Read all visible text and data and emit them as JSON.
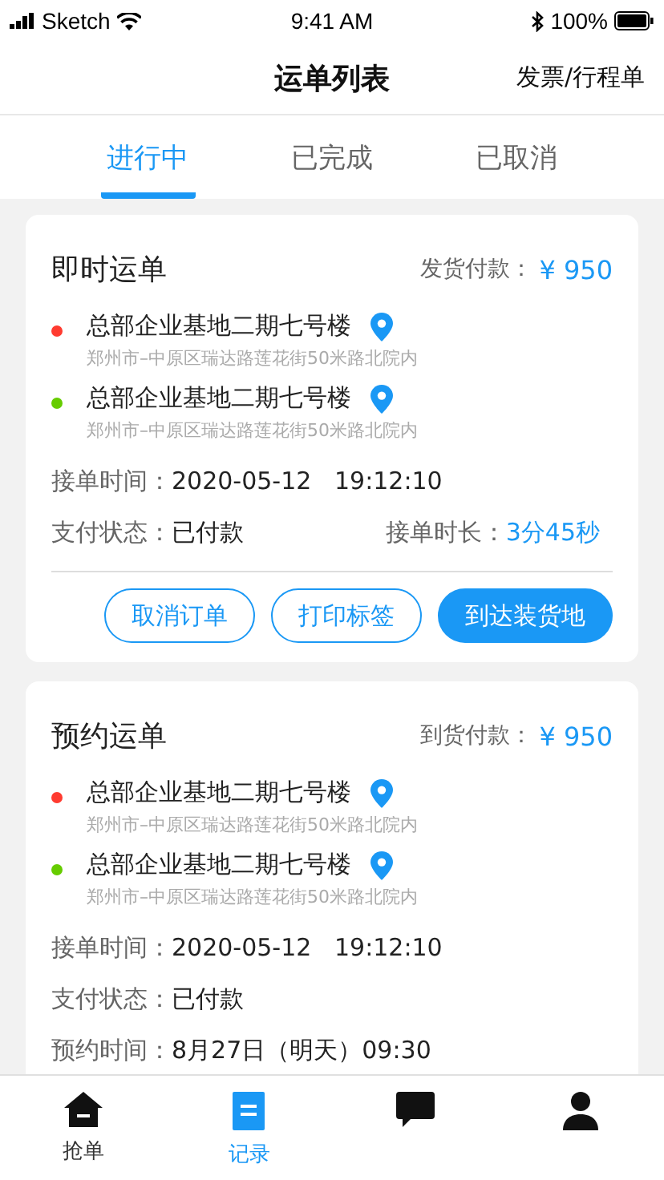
{
  "status_bar": {
    "carrier": "Sketch",
    "time": "9:41 AM",
    "battery": "100%"
  },
  "nav": {
    "title": "运单列表",
    "action": "发票/行程单"
  },
  "tabs": [
    {
      "label": "进行中",
      "selected": true
    },
    {
      "label": "已完成",
      "selected": false
    },
    {
      "label": "已取消",
      "selected": false
    }
  ],
  "orders": [
    {
      "type": "即时运单",
      "payment_label": "发货付款：",
      "amount": "¥ 950",
      "stops": [
        {
          "name": "总部企业基地二期七号楼",
          "address": "郑州市–中原区瑞达路莲花街50米路北院内",
          "color": "#ff3b30"
        },
        {
          "name": "总部企业基地二期七号楼",
          "address": "郑州市–中原区瑞达路莲花街50米路北院内",
          "color": "#66cc00"
        }
      ],
      "fields": [
        {
          "label": "接单时间：",
          "value": "2020-05-12   19:12:10",
          "kind": "plain"
        },
        {
          "label": "支付状态：",
          "value": "已付款",
          "kind": "pair",
          "extra_label": "接单时长：",
          "extra_value": "3分45秒"
        }
      ],
      "buttons": [
        {
          "label": "取消订单",
          "kind": "outline"
        },
        {
          "label": "打印标签",
          "kind": "outline"
        },
        {
          "label": "到达装货地",
          "kind": "filled"
        }
      ]
    },
    {
      "type": "预约运单",
      "payment_label": "到货付款：",
      "amount": "¥ 950",
      "stops": [
        {
          "name": "总部企业基地二期七号楼",
          "address": "郑州市–中原区瑞达路莲花街50米路北院内",
          "color": "#ff3b30"
        },
        {
          "name": "总部企业基地二期七号楼",
          "address": "郑州市–中原区瑞达路莲花街50米路北院内",
          "color": "#66cc00"
        }
      ],
      "fields": [
        {
          "label": "接单时间：",
          "value": "2020-05-12   19:12:10",
          "kind": "plain"
        },
        {
          "label": "支付状态：",
          "value": "已付款",
          "kind": "plain"
        },
        {
          "label": "预约时间：",
          "value": "8月27日（明天）09:30",
          "kind": "plain"
        }
      ]
    }
  ],
  "tab_bar": [
    {
      "label": "抢单",
      "kind": "home",
      "selected": false
    },
    {
      "label": "记录",
      "kind": "list",
      "selected": true
    },
    {
      "kind": "chat",
      "selected": false
    },
    {
      "kind": "person",
      "selected": false
    }
  ]
}
